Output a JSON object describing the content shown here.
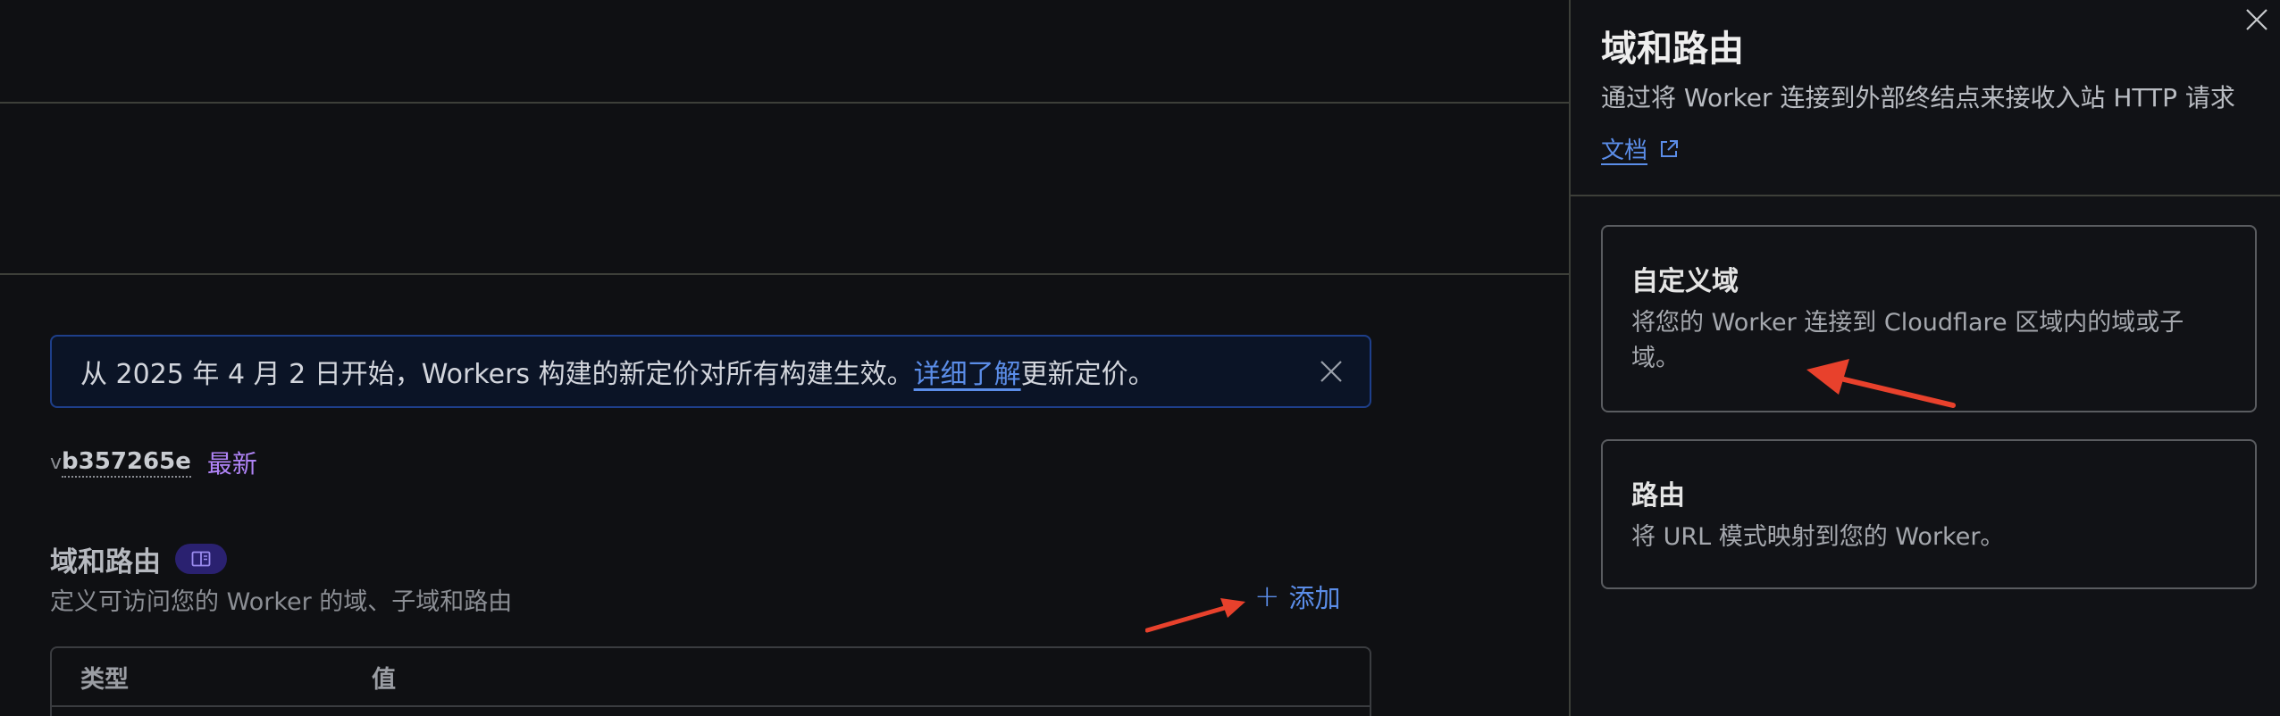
{
  "banner": {
    "text_before": "从 2025 年 4 月 2 日开始，Workers 构建的新定价对所有构建生效。",
    "link_text": "详细了解",
    "text_after": "更新定价。"
  },
  "version": {
    "prefix": "v",
    "hash": "b357265e",
    "tag": "最新"
  },
  "domains_section": {
    "title": "域和路由",
    "description": "定义可访问您的 Worker 的域、子域和路由",
    "add_label": "添加",
    "table_headers": [
      "类型",
      "值"
    ]
  },
  "drawer": {
    "title": "域和路由",
    "subtitle": "通过将 Worker 连接到外部终结点来接收入站 HTTP 请求",
    "doc_link": "文档",
    "options": [
      {
        "title": "自定义域",
        "description": "将您的 Worker 连接到 Cloudflare 区域内的域或子域。"
      },
      {
        "title": "路由",
        "description": "将 URL 模式映射到您的 Worker。"
      }
    ]
  },
  "colors": {
    "accent_link": "#5b8de8",
    "badge_purple": "#b084f7",
    "annotation_arrow": "#e8412c",
    "banner_border": "#1e3f8a"
  },
  "icons": {
    "banner_close": "close-icon",
    "drawer_close": "close-icon",
    "doc_external": "external-link-icon",
    "section_badge": "book-icon",
    "add": "plus-icon"
  }
}
